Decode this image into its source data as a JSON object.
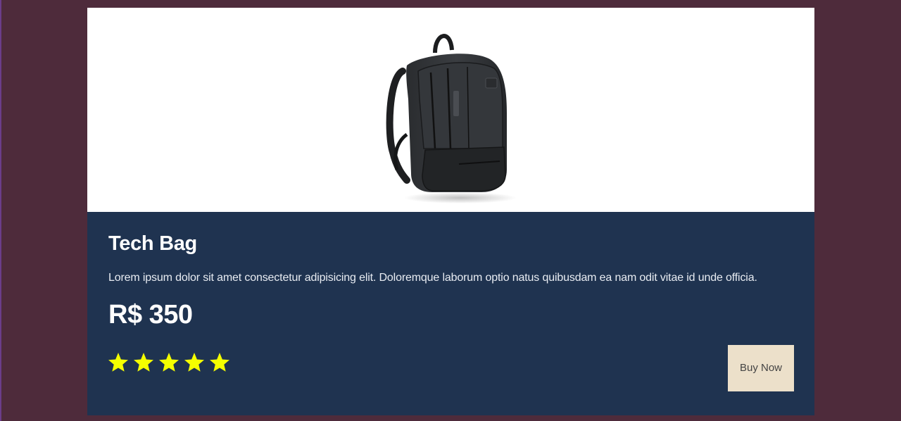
{
  "product": {
    "title": "Tech Bag",
    "description": "Lorem ipsum dolor sit amet consectetur adipisicing elit. Doloremque laborum optio natus quibusdam ea nam odit vitae id unde officia.",
    "price": "R$ 350",
    "rating": 5,
    "rating_max": 5,
    "image_icon": "backpack-image"
  },
  "actions": {
    "buy_label": "Buy Now"
  },
  "colors": {
    "page_background": "#4e2b3b",
    "card_background": "#1f3350",
    "star": "#f5ff00",
    "button_background": "#ece0ca"
  }
}
